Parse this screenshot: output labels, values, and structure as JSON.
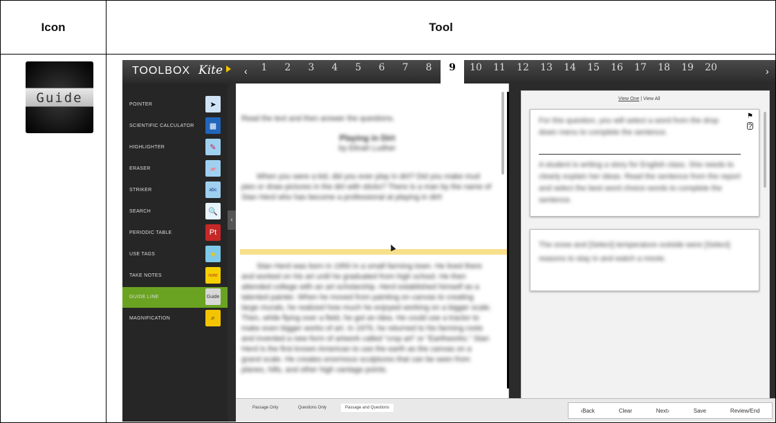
{
  "table": {
    "header_icon": "Icon",
    "header_tool": "Tool",
    "icon_label": "Guide"
  },
  "app": {
    "toolbox_title": "TOOLBOX",
    "logo": "Kite",
    "prev_arrow": "‹",
    "next_arrow": "›",
    "questions": [
      "1",
      "2",
      "3",
      "4",
      "5",
      "6",
      "7",
      "8",
      "9",
      "10",
      "11",
      "12",
      "13",
      "14",
      "15",
      "16",
      "17",
      "18",
      "19",
      "20"
    ],
    "active_question": "9"
  },
  "tools": [
    {
      "label": "POINTER",
      "icon": "pointer-icon",
      "glyph": "➤",
      "bg": "#cfe3f5",
      "fg": "#000"
    },
    {
      "label": "SCIENTIFIC CALCULATOR",
      "icon": "calculator-icon",
      "glyph": "▦",
      "bg": "#2266bb",
      "fg": "#fff"
    },
    {
      "label": "HIGHLIGHTER",
      "icon": "highlighter-icon",
      "glyph": "✎",
      "bg": "#9fd0f0",
      "fg": "#c2185b"
    },
    {
      "label": "ERASER",
      "icon": "eraser-icon",
      "glyph": "▰",
      "bg": "#9fd0f0",
      "fg": "#e88aa0"
    },
    {
      "label": "STRIKER",
      "icon": "striker-icon",
      "glyph": "abc",
      "bg": "#9fd0f0",
      "fg": "#1a3a8a"
    },
    {
      "label": "SEARCH",
      "icon": "search-icon",
      "glyph": "🔍",
      "bg": "#e8f4fb",
      "fg": "#1565c0"
    },
    {
      "label": "PERIODIC TABLE",
      "icon": "periodic-table-icon",
      "glyph": "Pt",
      "bg": "#c62828",
      "fg": "#fff"
    },
    {
      "label": "USE TAGS",
      "icon": "star-icon",
      "glyph": "★",
      "bg": "#7ec8ea",
      "fg": "#f5c400"
    },
    {
      "label": "TAKE NOTES",
      "icon": "note-icon",
      "glyph": "note",
      "bg": "#f5d000",
      "fg": "#c0392b"
    },
    {
      "label": "GUIDE LINE",
      "icon": "guide-icon",
      "glyph": "Guide",
      "bg": "#d8d8d8",
      "fg": "#333"
    },
    {
      "label": "MAGNIFICATION",
      "icon": "magnify-icon",
      "glyph": "⌕",
      "bg": "#f5c400",
      "fg": "#222"
    }
  ],
  "active_tool": "GUIDE LINE",
  "passage": {
    "instruction": "Read the text and then answer the questions.",
    "title": "Playing in Dirt",
    "byline": "by Elinah Ludher",
    "p1": "When you were a kid, did you ever play in dirt? Did you make mud pies or draw pictures in the dirt with sticks? There is a man by the name of Stan Herd who has become a professional at playing in dirt!",
    "p2": "Stan Herd was born in 1950 in a small farming town. He lived there and worked on his art until he graduated from high school. He then attended college with an art scholarship. Herd established himself as a talented painter. When he moved from painting on canvas to creating large murals, he realized how much he enjoyed working on a bigger scale. Then, while flying over a field, he got an idea. He could use a tractor to make even bigger works of art. In 1976, he returned to his farming roots and invented a new form of artwork called “crop art” or “Earthworks.” Stan Herd is the first known American to use the earth as the canvas on a grand scale. He creates enormous sculptures that can be seen from planes, hills, and other high vantage points."
  },
  "question_panel": {
    "view_one": "View One",
    "view_sep": "|",
    "view_all": "View All",
    "q_intro": "For this question, you will select a word from the drop down menu to complete the sentence.",
    "q_body": "A student is writing a story for English class. She needs to clearly explain her ideas. Read the sentence from the report and select the best word choice words to complete the sentence.",
    "answer_text": "The snow and [Select] temperature outside were [Select] reasons to stay in and watch a movie."
  },
  "bottom": {
    "tabs": [
      "Passage Only",
      "Questions Only",
      "Passage and Questions"
    ],
    "selected_tab": "Passage and Questions",
    "back": "‹Back",
    "clear": "Clear",
    "next": "Next›",
    "save": "Save",
    "review": "Review/End"
  }
}
